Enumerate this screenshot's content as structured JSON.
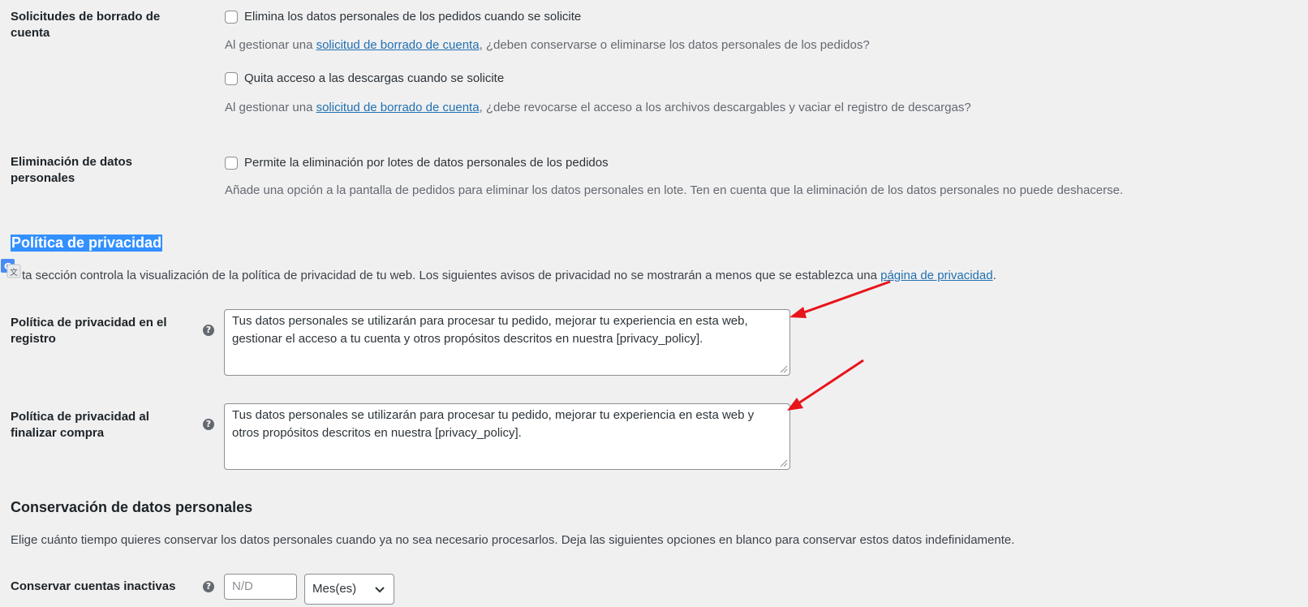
{
  "account_erasure": {
    "label": "Solicitudes de borrado de cuenta",
    "orders_checkbox_label": "Elimina los datos personales de los pedidos cuando se solicite",
    "orders_desc_before": "Al gestionar una ",
    "orders_desc_link": "solicitud de borrado de cuenta",
    "orders_desc_after": ", ¿deben conservarse o eliminarse los datos personales de los pedidos?",
    "downloads_checkbox_label": "Quita acceso a las descargas cuando se solicite",
    "downloads_desc_before": "Al gestionar una ",
    "downloads_desc_link": "solicitud de borrado de cuenta",
    "downloads_desc_after": ", ¿debe revocarse el acceso a los archivos descargables y vaciar el registro de descargas?"
  },
  "personal_data_removal": {
    "label": "Eliminación de datos personales",
    "checkbox_label": "Permite la eliminación por lotes de datos personales de los pedidos",
    "desc": "Añade una opción a la pantalla de pedidos para eliminar los datos personales en lote. Ten en cuenta que la eliminación de los datos personales no puede deshacerse."
  },
  "privacy_policy": {
    "title": "Política de privacidad",
    "intro_before": "ta sección controla la visualización de la política de privacidad de tu web. Los siguientes avisos de privacidad no se mostrarán a menos que se establezca una ",
    "intro_link": "página de privacidad",
    "intro_after": ".",
    "registration_label": "Política de privacidad en el registro",
    "registration_text": "Tus datos personales se utilizarán para procesar tu pedido, mejorar tu experiencia en esta web, gestionar el acceso a tu cuenta y otros propósitos descritos en nuestra [privacy_policy].",
    "checkout_label": "Política de privacidad al finalizar compra",
    "checkout_text": "Tus datos personales se utilizarán para procesar tu pedido, mejorar tu experiencia en esta web y otros propósitos descritos en nuestra [privacy_policy].",
    "help_glyph": "?"
  },
  "retention": {
    "title": "Conservación de datos personales",
    "desc": "Elige cuánto tiempo quieres conservar los datos personales cuando ya no sea necesario procesarlos. Deja las siguientes opciones en blanco para conservar estos datos indefinidamente.",
    "inactive_label": "Conservar cuentas inactivas",
    "inactive_placeholder": "N/D",
    "inactive_unit": "Mes(es)"
  },
  "icons": {
    "help": "help-icon",
    "translate": "google-translate-icon",
    "chevron": "chevron-down-icon",
    "annotation_arrow": "red-arrow"
  },
  "colors": {
    "background": "#f0f0f1",
    "link": "#2271b1",
    "selection": "#3390ff",
    "annotation": "#e8141b"
  }
}
